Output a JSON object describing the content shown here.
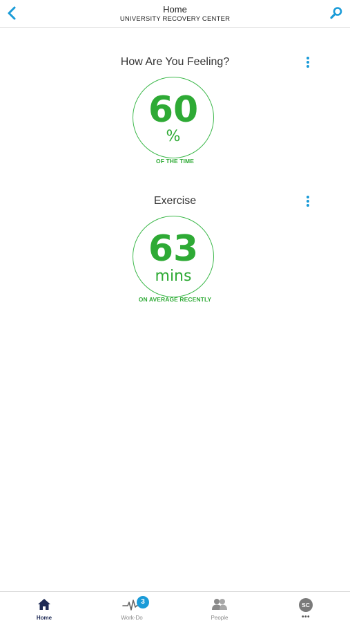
{
  "header": {
    "title": "Home",
    "subtitle": "UNIVERSITY RECOVERY CENTER",
    "back_icon": "chevron-left-icon",
    "search_icon": "search-icon"
  },
  "cards": [
    {
      "title": "How Are You Feeling?",
      "value": "60",
      "unit": "%",
      "caption": "OF THE TIME"
    },
    {
      "title": "Exercise",
      "value": "63",
      "unit": "mins",
      "caption": "ON AVERAGE RECENTLY"
    }
  ],
  "bottom_nav": {
    "items": [
      {
        "label": "Home",
        "icon": "home-icon",
        "active": true
      },
      {
        "label": "Work-Do",
        "icon": "heartbeat-icon",
        "badge": "3"
      },
      {
        "label": "People",
        "icon": "people-icon"
      },
      {
        "avatar_initials": "SC",
        "label": "•••",
        "icon": "avatar-icon"
      }
    ]
  },
  "colors": {
    "accent_blue": "#1a9bd8",
    "metric_green": "#2eaa35",
    "nav_active": "#1e2a55"
  }
}
